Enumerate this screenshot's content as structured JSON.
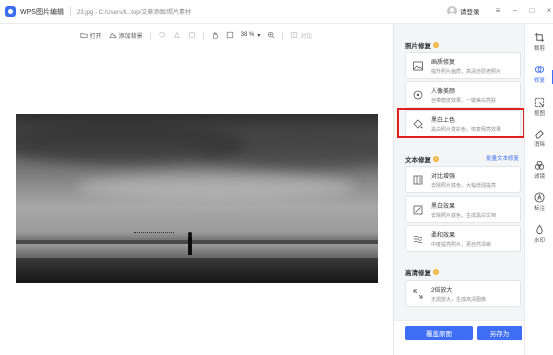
{
  "window": {
    "app_name": "WPS图片编辑",
    "file_path": "23.jpg - C:/Users/li...top/文章添图/照片素材",
    "login_label": "请登录",
    "controls": [
      "≡",
      "–",
      "□",
      "×"
    ]
  },
  "toolbar": {
    "open_label": "打开",
    "add_bg_label": "添加背景",
    "zoom_value": "38 %",
    "compare_label": "对比"
  },
  "panel": {
    "photo_repair": {
      "title": "照片修复",
      "cards": [
        {
          "title": "画质修复",
          "desc": "提升照片画质，高清还原老照片",
          "icon": "image-enhance-icon"
        },
        {
          "title": "人像美颜",
          "desc": "自带磨皮效果，一键美白亮肤",
          "icon": "face-beauty-icon"
        },
        {
          "title": "黑白上色",
          "desc": "黑白照片变彩色，恢复明亮效果",
          "icon": "colorize-icon"
        }
      ]
    },
    "text_repair": {
      "title": "文本修复",
      "link": "批量文本修复",
      "cards": [
        {
          "title": "对比增强",
          "desc": "去除照片底色，大幅增强提亮",
          "icon": "contrast-icon"
        },
        {
          "title": "黑白效果",
          "desc": "去除照片底色，生成黑白文档",
          "icon": "black-white-icon"
        },
        {
          "title": "柔和效果",
          "desc": "中度提亮照片，更自然清晰",
          "icon": "soft-effect-icon"
        }
      ]
    },
    "hd_repair": {
      "title": "高清修复",
      "cards": [
        {
          "title": "2倍放大",
          "desc": "无损放大，生成高清图像",
          "icon": "upscale-icon"
        }
      ]
    },
    "footer": {
      "restore_label": "覆盖原图",
      "save_as_label": "另存为",
      "dropdown": "▲"
    }
  },
  "sidebar": {
    "items": [
      {
        "label": "裁剪",
        "icon": "crop-icon"
      },
      {
        "label": "修复",
        "icon": "repair-icon"
      },
      {
        "label": "抠图",
        "icon": "cutout-icon"
      },
      {
        "label": "消除",
        "icon": "eraser-icon"
      },
      {
        "label": "滤镜",
        "icon": "filter-icon"
      },
      {
        "label": "标注",
        "icon": "annotate-icon"
      },
      {
        "label": "水印",
        "icon": "watermark-icon"
      }
    ]
  },
  "colors": {
    "accent": "#3d6ef5",
    "highlight_box": "#e02020",
    "panel_bg": "#f4f5f7"
  }
}
